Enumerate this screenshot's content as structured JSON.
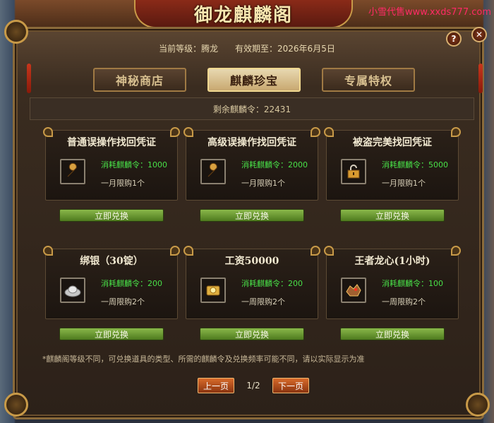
{
  "header": {
    "title": "御龙麒麟阁",
    "watermark": "小雪代售www.xxds777.com",
    "level_label": "当前等级：腾龙",
    "expiry_label": "有效期至：2026年6月5日"
  },
  "tabs": [
    {
      "label": "神秘商店",
      "active": false
    },
    {
      "label": "麒麟珍宝",
      "active": true
    },
    {
      "label": "专属特权",
      "active": false
    }
  ],
  "remaining": "剩余麒麟令：22431",
  "items": [
    {
      "name": "普通误操作找回凭证",
      "cost": "消耗麒麟令：1000",
      "limit": "一月限购1个",
      "button": "立即兑换",
      "icon": "wrench-icon"
    },
    {
      "name": "高级误操作找回凭证",
      "cost": "消耗麒麟令：2000",
      "limit": "一月限购1个",
      "button": "立即兑换",
      "icon": "wrench-icon"
    },
    {
      "name": "被盗完美找回凭证",
      "cost": "消耗麒麟令：5000",
      "limit": "一月限购1个",
      "button": "立即兑换",
      "icon": "lock-icon"
    },
    {
      "name": "绑银（30锭）",
      "cost": "消耗麒麟令：200",
      "limit": "一周限购2个",
      "button": "立即兑换",
      "icon": "silver-ingot-icon"
    },
    {
      "name": "工资50000",
      "cost": "消耗麒麟令：200",
      "limit": "一周限购2个",
      "button": "立即兑换",
      "icon": "gold-scroll-icon"
    },
    {
      "name": "王者龙心(1小时)",
      "cost": "消耗麒麟令：100",
      "limit": "一周限购2个",
      "button": "立即兑换",
      "icon": "dragon-heart-icon"
    }
  ],
  "note": "*麒麟阁等级不同，可兑换道具的类型、所需的麒麟令及兑换频率可能不同，请以实际显示为准",
  "pager": {
    "prev": "上一页",
    "page": "1/2",
    "next": "下一页"
  },
  "controls": {
    "help": "?",
    "close": "✕"
  }
}
